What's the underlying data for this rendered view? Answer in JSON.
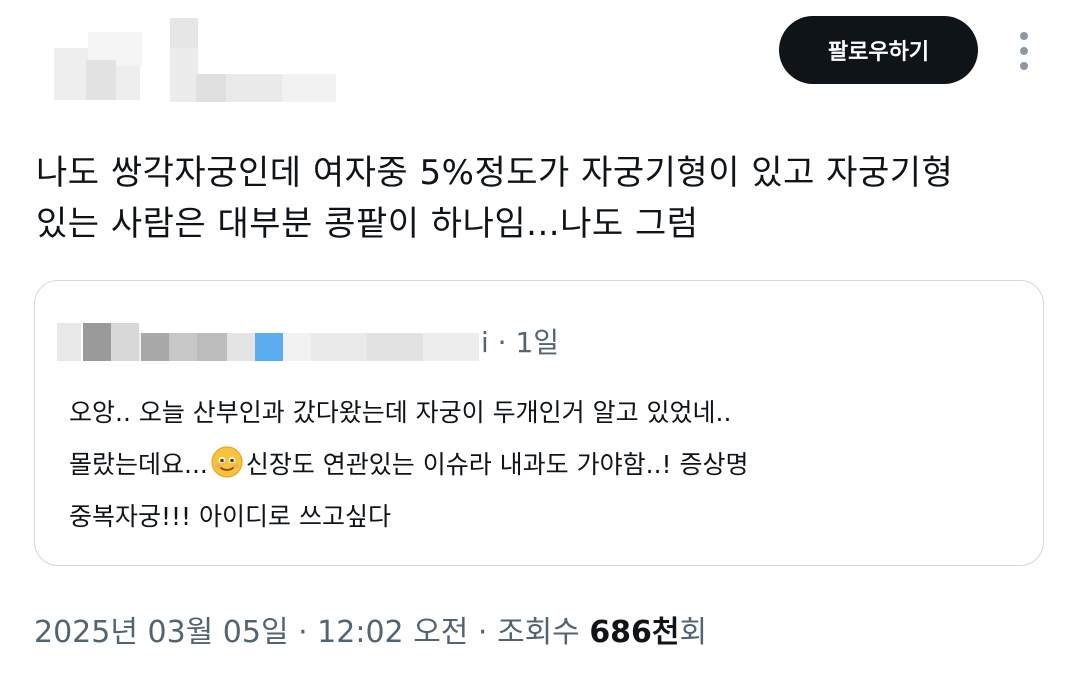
{
  "header": {
    "follow_label": "팔로우하기",
    "more_icon": "more-vertical-icon"
  },
  "tweet": {
    "line1": "나도 쌍각자궁인데 여자중 5%정도가 자궁기형이 있고 자궁기형",
    "line2": "있는 사람은 대부분 콩팥이 하나임...나도 그럼"
  },
  "quote": {
    "time_suffix": "i · 1일",
    "line1": "오앙.. 오늘 산부인과 갔다왔는데 자궁이 두개인거 알고 있었네..",
    "line2_before_emoji": "몰랐는데요...",
    "emoji": "smiling-face-with-tear-emoji",
    "line2_after_emoji": "신장도 연관있는 이슈라 내과도 가야함..! 증상명",
    "line3": "중복자궁!!! 아이디로 쓰고싶다"
  },
  "footer": {
    "timestamp": "2025년 03월 05일 · 12:02 오전 · 조회수 ",
    "views": "686천",
    "views_suffix": "회"
  },
  "colors": {
    "follow_bg": "#0f1419",
    "muted_text": "#536471",
    "border": "#cfd9de",
    "blur_accent": "#5aaef0"
  }
}
